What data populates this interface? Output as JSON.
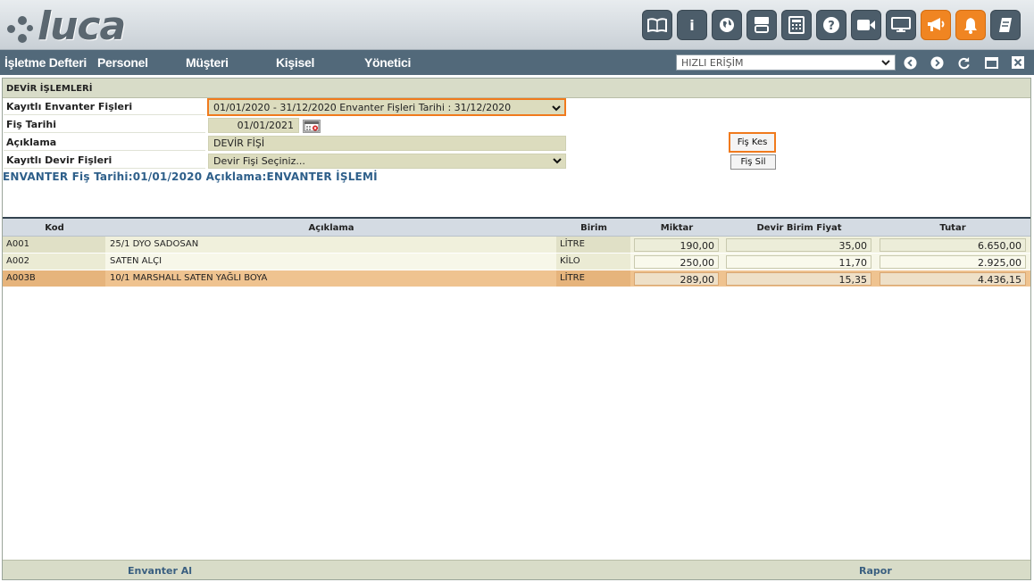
{
  "app": {
    "logo_text": "luca"
  },
  "toolbar": {
    "icons": [
      "book-icon",
      "info-icon",
      "globe-icon",
      "youtube-icon",
      "calculator-icon",
      "help-icon",
      "video-icon",
      "monitor-icon",
      "megaphone-icon",
      "bell-icon",
      "notebook-icon"
    ],
    "info_glyph": "i",
    "help_glyph": "?",
    "accent": "#f08522"
  },
  "menu": {
    "items": [
      "İşletme Defteri",
      "Personel",
      "Müşteri",
      "Kişisel",
      "Yönetici"
    ],
    "quick_access": "HIZLI ERİŞİM"
  },
  "panel": {
    "title": "DEVİR İŞLEMLERİ",
    "fields": {
      "kayitli_envanter_label": "Kayıtlı Envanter Fişleri",
      "kayitli_envanter_value": "01/01/2020 - 31/12/2020 Envanter Fişleri Tarihi : 31/12/2020",
      "fis_tarihi_label": "Fiş Tarihi",
      "fis_tarihi_value": "01/01/2021",
      "aciklama_label": "Açıklama",
      "aciklama_value": "DEVİR FİŞİ",
      "kayitli_devir_label": "Kayıtlı Devir Fişleri",
      "kayitli_devir_value": "Devir Fişi Seçiniz..."
    },
    "buttons": {
      "fis_kes": "Fiş Kes",
      "fis_sil": "Fiş Sil"
    },
    "envanter_title": "ENVANTER Fiş Tarihi:01/01/2020 Açıklama:ENVANTER İŞLEMİ"
  },
  "grid": {
    "columns": [
      "Kod",
      "Açıklama",
      "Birim",
      "Miktar",
      "Devir Birim Fiyat",
      "Tutar"
    ],
    "rows": [
      {
        "kod": "A001",
        "aciklama": "25/1 DYO SADOSAN",
        "birim": "LİTRE",
        "miktar": "190,00",
        "fiyat": "35,00",
        "tutar": "6.650,00"
      },
      {
        "kod": "A002",
        "aciklama": "SATEN ALÇI",
        "birim": "KİLO",
        "miktar": "250,00",
        "fiyat": "11,70",
        "tutar": "2.925,00"
      },
      {
        "kod": "A003B",
        "aciklama": "10/1 MARSHALL SATEN YAĞLI BOYA",
        "birim": "LİTRE",
        "miktar": "289,00",
        "fiyat": "15,35",
        "tutar": "4.436,15"
      }
    ]
  },
  "footer": {
    "envanter_al": "Envanter Al",
    "rapor": "Rapor"
  }
}
